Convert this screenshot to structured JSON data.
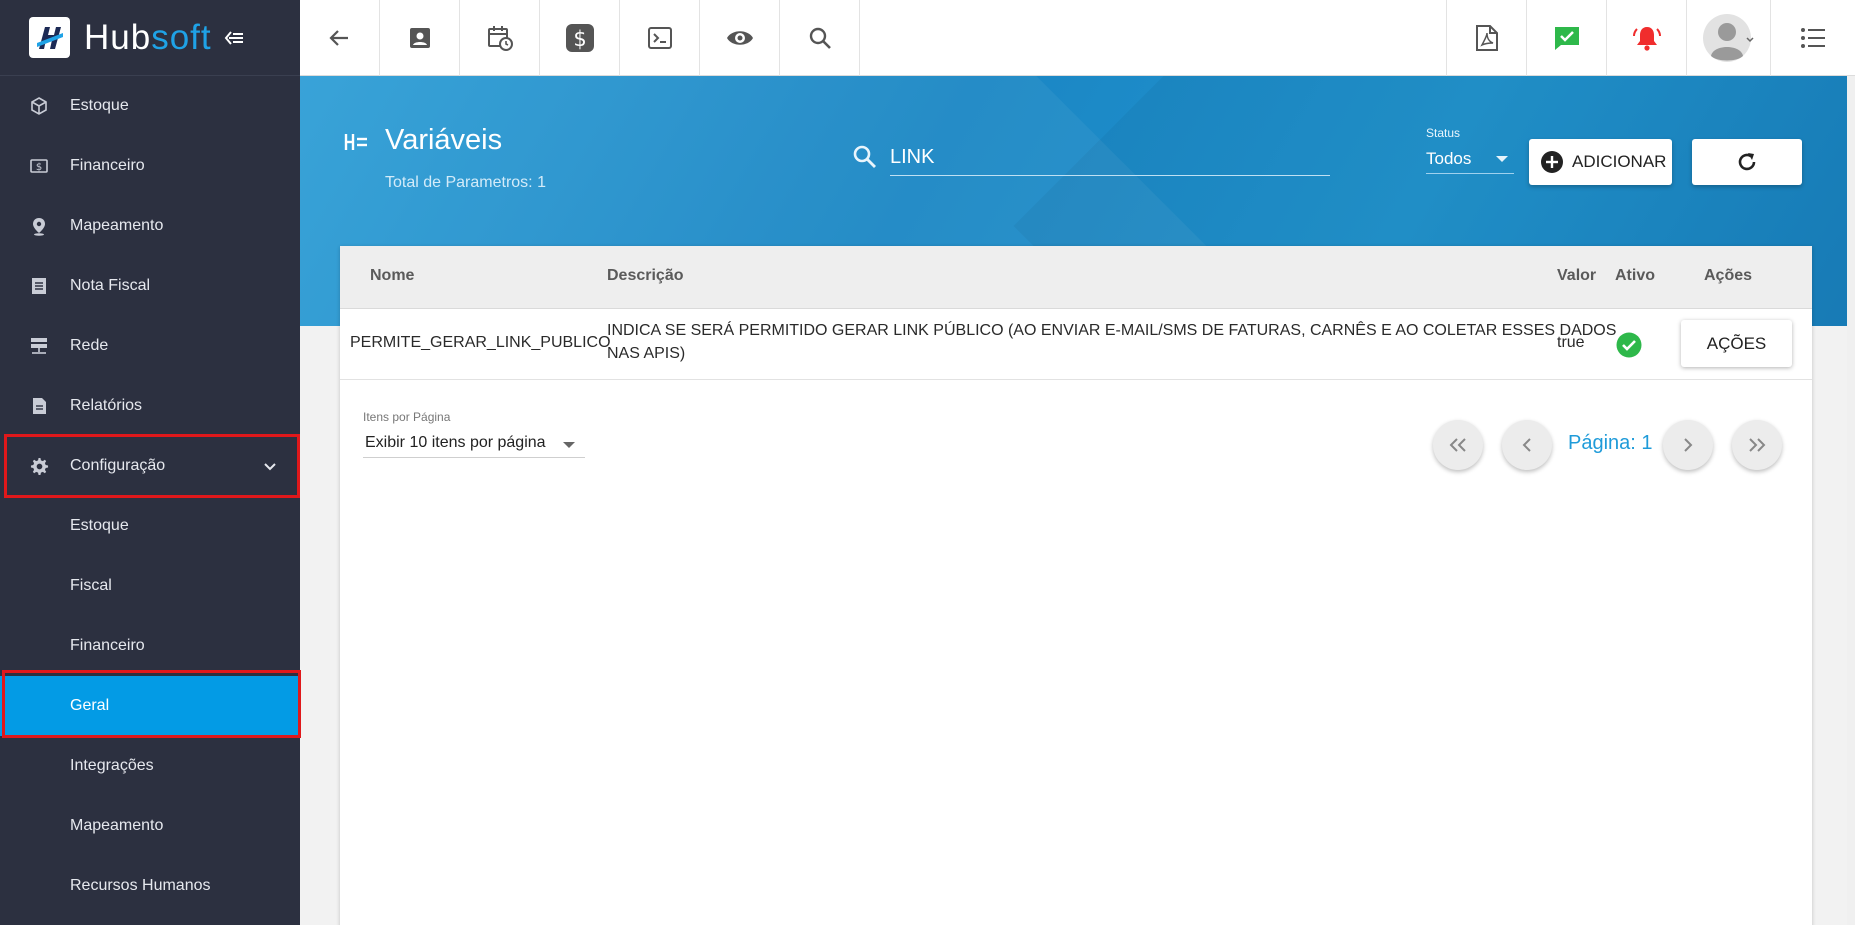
{
  "brand": {
    "part1": "Hub",
    "part2": "soft"
  },
  "sidebar": {
    "items": [
      {
        "label": "Estoque",
        "icon": "box-icon"
      },
      {
        "label": "Financeiro",
        "icon": "money-icon"
      },
      {
        "label": "Mapeamento",
        "icon": "map-pin-icon"
      },
      {
        "label": "Nota Fiscal",
        "icon": "receipt-icon"
      },
      {
        "label": "Rede",
        "icon": "network-icon"
      },
      {
        "label": "Relatórios",
        "icon": "report-icon"
      },
      {
        "label": "Configuração",
        "icon": "gear-icon"
      }
    ],
    "subitems": [
      {
        "label": "Estoque"
      },
      {
        "label": "Fiscal"
      },
      {
        "label": "Financeiro"
      },
      {
        "label": "Geral"
      },
      {
        "label": "Integrações"
      },
      {
        "label": "Mapeamento"
      },
      {
        "label": "Recursos Humanos"
      }
    ]
  },
  "header": {
    "title": "Variáveis",
    "subtitle": "Total de Parametros: 1",
    "search": {
      "value": "LINK",
      "placeholder": ""
    },
    "status": {
      "label": "Status",
      "value": "Todos"
    },
    "add_label": "ADICIONAR"
  },
  "table": {
    "columns": {
      "nome": "Nome",
      "descricao": "Descrição",
      "valor": "Valor",
      "ativo": "Ativo",
      "acoes": "Ações"
    },
    "rows": [
      {
        "nome": "PERMITE_GERAR_LINK_PUBLICO",
        "descricao_line1": "INDICA SE SERÁ PERMITIDO GERAR LINK PÚBLICO (AO ENVIAR E-MAIL/SMS DE FATURAS, CARNÊS E AO COLETAR ESSES DADOS",
        "descricao_line2": "NAS APIS)",
        "valor": "true",
        "acoes_label": "AÇÕES"
      }
    ]
  },
  "pagination": {
    "per_page_label": "Itens por Página",
    "per_page_value": "Exibir 10 itens por página",
    "page_label": "Página: 1"
  },
  "colors": {
    "sidebar_bg": "#2c3040",
    "active": "#039be5",
    "accent": "#1f9bd9",
    "highlight_box": "#e0181b",
    "success": "#2eb84a",
    "alert": "#f02d2d"
  }
}
